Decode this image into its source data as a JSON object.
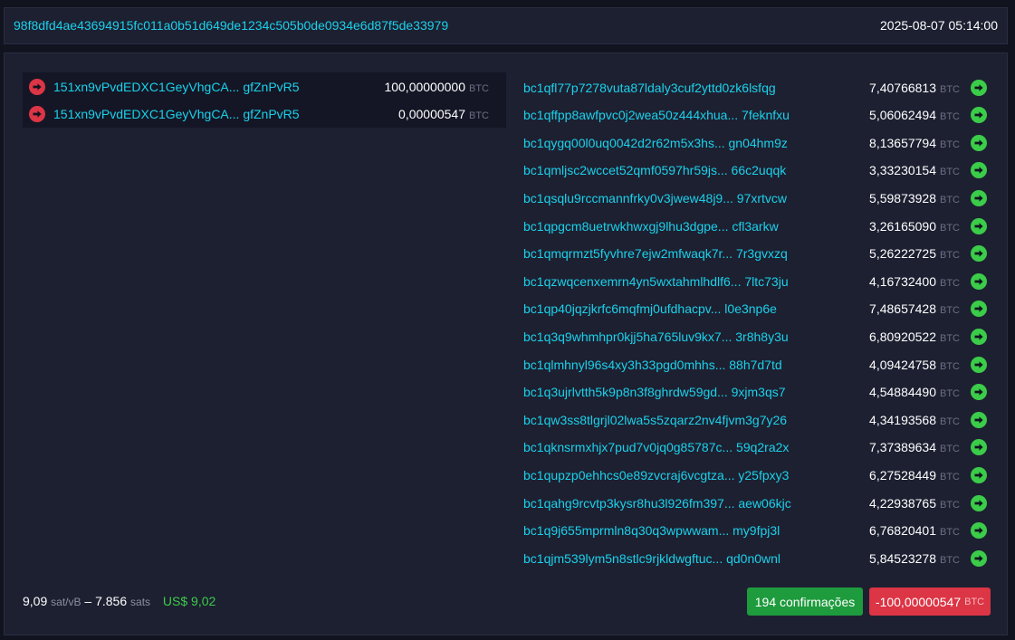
{
  "header": {
    "txid": "98f8dfd4ae43694915fc011a0b51d649de1234c505b0de0934e6d87f5de33979",
    "timestamp": "2025-08-07 05:14:00"
  },
  "unit_label": "BTC",
  "colors": {
    "accent": "#1bd1ea",
    "input_arrow": "#dc3545",
    "output_arrow": "#3bcc49"
  },
  "icons": {
    "input": "arrow-right-circle-red",
    "output": "arrow-right-circle-green"
  },
  "inputs": [
    {
      "address": "151xn9vPvdEDXC1GeyVhgCA... gfZnPvR5",
      "amount": "100,00000000",
      "unit": "BTC"
    },
    {
      "address": "151xn9vPvdEDXC1GeyVhgCA... gfZnPvR5",
      "amount": "0,00000547",
      "unit": "BTC"
    }
  ],
  "outputs": [
    {
      "address": "bc1qfl77p7278vuta87ldaly3cuf2yttd0zk6lsfqg",
      "amount": "7,40766813",
      "unit": "BTC"
    },
    {
      "address": "bc1qffpp8awfpvc0j2wea50z444xhua... 7feknfxu",
      "amount": "5,06062494",
      "unit": "BTC"
    },
    {
      "address": "bc1qygq00l0uq0042d2r62m5x3hs... gn04hm9z",
      "amount": "8,13657794",
      "unit": "BTC"
    },
    {
      "address": "bc1qmljsc2wccet52qmf0597hr59js... 66c2uqqk",
      "amount": "3,33230154",
      "unit": "BTC"
    },
    {
      "address": "bc1qsqlu9rccmannfrky0v3jwew48j9... 97xrtvcw",
      "amount": "5,59873928",
      "unit": "BTC"
    },
    {
      "address": "bc1qpgcm8uetrwkhwxgj9lhu3dgpe... cfl3arkw",
      "amount": "3,26165090",
      "unit": "BTC"
    },
    {
      "address": "bc1qmqrmzt5fyvhre7ejw2mfwaqk7r... 7r3gvxzq",
      "amount": "5,26222725",
      "unit": "BTC"
    },
    {
      "address": "bc1qzwqcenxemrn4yn5wxtahmlhdlf6... 7ltc73ju",
      "amount": "4,16732400",
      "unit": "BTC"
    },
    {
      "address": "bc1qp40jqzjkrfc6mqfmj0ufdhacpv... l0e3np6e",
      "amount": "7,48657428",
      "unit": "BTC"
    },
    {
      "address": "bc1q3q9whmhpr0kjj5ha765luv9kx7... 3r8h8y3u",
      "amount": "6,80920522",
      "unit": "BTC"
    },
    {
      "address": "bc1qlmhnyl96s4xy3h33pgd0mhhs... 88h7d7td",
      "amount": "4,09424758",
      "unit": "BTC"
    },
    {
      "address": "bc1q3ujrlvtth5k9p8n3f8ghrdw59gd... 9xjm3qs7",
      "amount": "4,54884490",
      "unit": "BTC"
    },
    {
      "address": "bc1qw3ss8tlgrjl02lwa5s5zqarz2nv4fjvm3g7y26",
      "amount": "4,34193568",
      "unit": "BTC"
    },
    {
      "address": "bc1qknsrmxhjx7pud7v0jq0g85787c... 59q2ra2x",
      "amount": "7,37389634",
      "unit": "BTC"
    },
    {
      "address": "bc1qupzp0ehhcs0e89zvcraj6vcgtza... y25fpxy3",
      "amount": "6,27528449",
      "unit": "BTC"
    },
    {
      "address": "bc1qahg9rcvtp3kysr8hu3l926fm397... aew06kjc",
      "amount": "4,22938765",
      "unit": "BTC"
    },
    {
      "address": "bc1q9j655mprmln8q30q3wpwwam... my9fpj3l",
      "amount": "6,76820401",
      "unit": "BTC"
    },
    {
      "address": "bc1qjm539lym5n8stlc9rjkldwgftuc... qd0n0wnl",
      "amount": "5,84523278",
      "unit": "BTC"
    }
  ],
  "footer": {
    "fee_rate": "9,09",
    "fee_rate_unit": "sat/vB",
    "separator": "–",
    "fee_sats": "7.856",
    "fee_sats_unit": "sats",
    "fiat": "US$ 9,02",
    "confirmations": "194 confirmações",
    "total": "-100,00000547",
    "total_unit": "BTC"
  }
}
